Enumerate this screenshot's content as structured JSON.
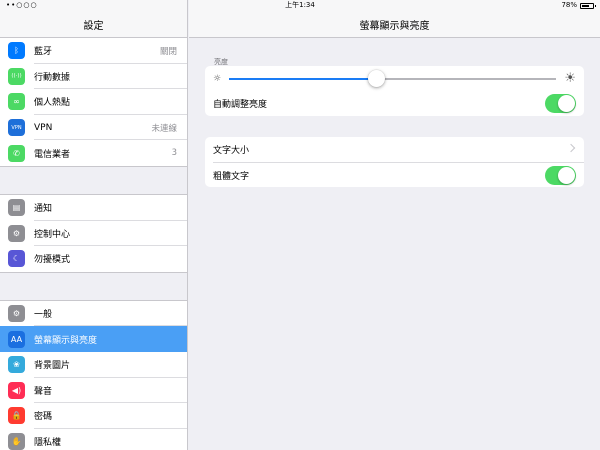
{
  "statusbar": {
    "signal": "••○○○",
    "time": "上午1:34",
    "battery": "78%",
    "battery_level": 0.78
  },
  "sidebar": {
    "title": "設定",
    "groups": [
      [
        {
          "label": "藍牙",
          "value": "關閉",
          "icon": "bluetooth-icon",
          "glyph": "ᛒ",
          "color": "#007aff"
        },
        {
          "label": "行動數據",
          "value": "",
          "icon": "cellular-antenna-icon",
          "glyph": "((·))",
          "color": "#4cd964"
        },
        {
          "label": "個人熱點",
          "value": "",
          "icon": "hotspot-link-icon",
          "glyph": "∞",
          "color": "#4cd964"
        },
        {
          "label": "VPN",
          "value": "未連線",
          "icon": "vpn-icon",
          "glyph": "VPN",
          "color": "#1e6fd9"
        },
        {
          "label": "電信業者",
          "value": "3",
          "icon": "phone-icon",
          "glyph": "✆",
          "color": "#4cd964"
        }
      ],
      [
        {
          "label": "通知",
          "value": "",
          "icon": "notifications-icon",
          "glyph": "▤",
          "color": "#8e8e93"
        },
        {
          "label": "控制中心",
          "value": "",
          "icon": "control-center-icon",
          "glyph": "⚙",
          "color": "#8e8e93"
        },
        {
          "label": "勿擾模式",
          "value": "",
          "icon": "moon-icon",
          "glyph": "☾",
          "color": "#5856d6"
        }
      ],
      [
        {
          "label": "一般",
          "value": "",
          "icon": "gear-icon",
          "glyph": "⚙",
          "color": "#8e8e93"
        },
        {
          "label": "螢幕顯示與亮度",
          "value": "",
          "icon": "display-brightness-icon",
          "glyph": "AA",
          "color": "#1a6fe0",
          "selected": true
        },
        {
          "label": "背景圖片",
          "value": "",
          "icon": "wallpaper-flower-icon",
          "glyph": "❀",
          "color": "#34aadc"
        },
        {
          "label": "聲音",
          "value": "",
          "icon": "speaker-icon",
          "glyph": "◀)",
          "color": "#ff2d55"
        },
        {
          "label": "密碼",
          "value": "",
          "icon": "lock-icon",
          "glyph": "🔒",
          "color": "#ff3b30"
        },
        {
          "label": "隱私權",
          "value": "",
          "icon": "privacy-hand-icon",
          "glyph": "✋",
          "color": "#8e8e93"
        }
      ]
    ]
  },
  "main": {
    "title": "螢幕顯示與亮度",
    "brightness_caption": "亮度",
    "brightness_level": 0.45,
    "auto_brightness_label": "自動調整亮度",
    "auto_brightness_on": true,
    "text_size_label": "文字大小",
    "bold_text_label": "粗體文字",
    "bold_text_on": true
  },
  "colors": {
    "accent": "#1a7cf5",
    "toggle_on": "#4cd964",
    "selected_row": "#4a9ff5"
  }
}
